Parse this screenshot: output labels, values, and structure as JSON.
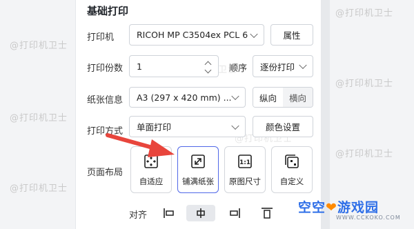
{
  "section_title": "基础打印",
  "printer": {
    "label": "打印机",
    "value": "RICOH MP C3504ex PCL 6",
    "props_button": "属性"
  },
  "copies": {
    "label": "打印份数",
    "value": "1"
  },
  "order": {
    "label": "顺序",
    "value": "逐份打印"
  },
  "paper": {
    "label": "纸张信息",
    "value": "A3 (297 x 420 mm) ...",
    "portrait": "纵向",
    "landscape": "横向"
  },
  "mode": {
    "label": "打印方式",
    "value": "单面打印",
    "color_button": "颜色设置"
  },
  "layout": {
    "label": "页面布局",
    "options": [
      {
        "label": "自适应",
        "icon": "fit-icon"
      },
      {
        "label": "铺满纸张",
        "icon": "fill-expand-icon",
        "selected": true
      },
      {
        "label": "原图尺寸",
        "icon": "original-size-icon"
      },
      {
        "label": "自定义",
        "icon": "custom-icon"
      }
    ]
  },
  "align": {
    "label": "对齐",
    "options": [
      "align-left-icon",
      "align-center-icon",
      "align-right-icon",
      "align-top-icon"
    ],
    "selected": "align-center-icon"
  },
  "watermark_text": "@打印机卫士",
  "site_logo": {
    "name_a": "空空",
    "name_b": "游戏园",
    "url": "WWW.CCKOKO.COM"
  },
  "colors": {
    "accent": "#4f67e8",
    "arrow": "#e8453c"
  }
}
